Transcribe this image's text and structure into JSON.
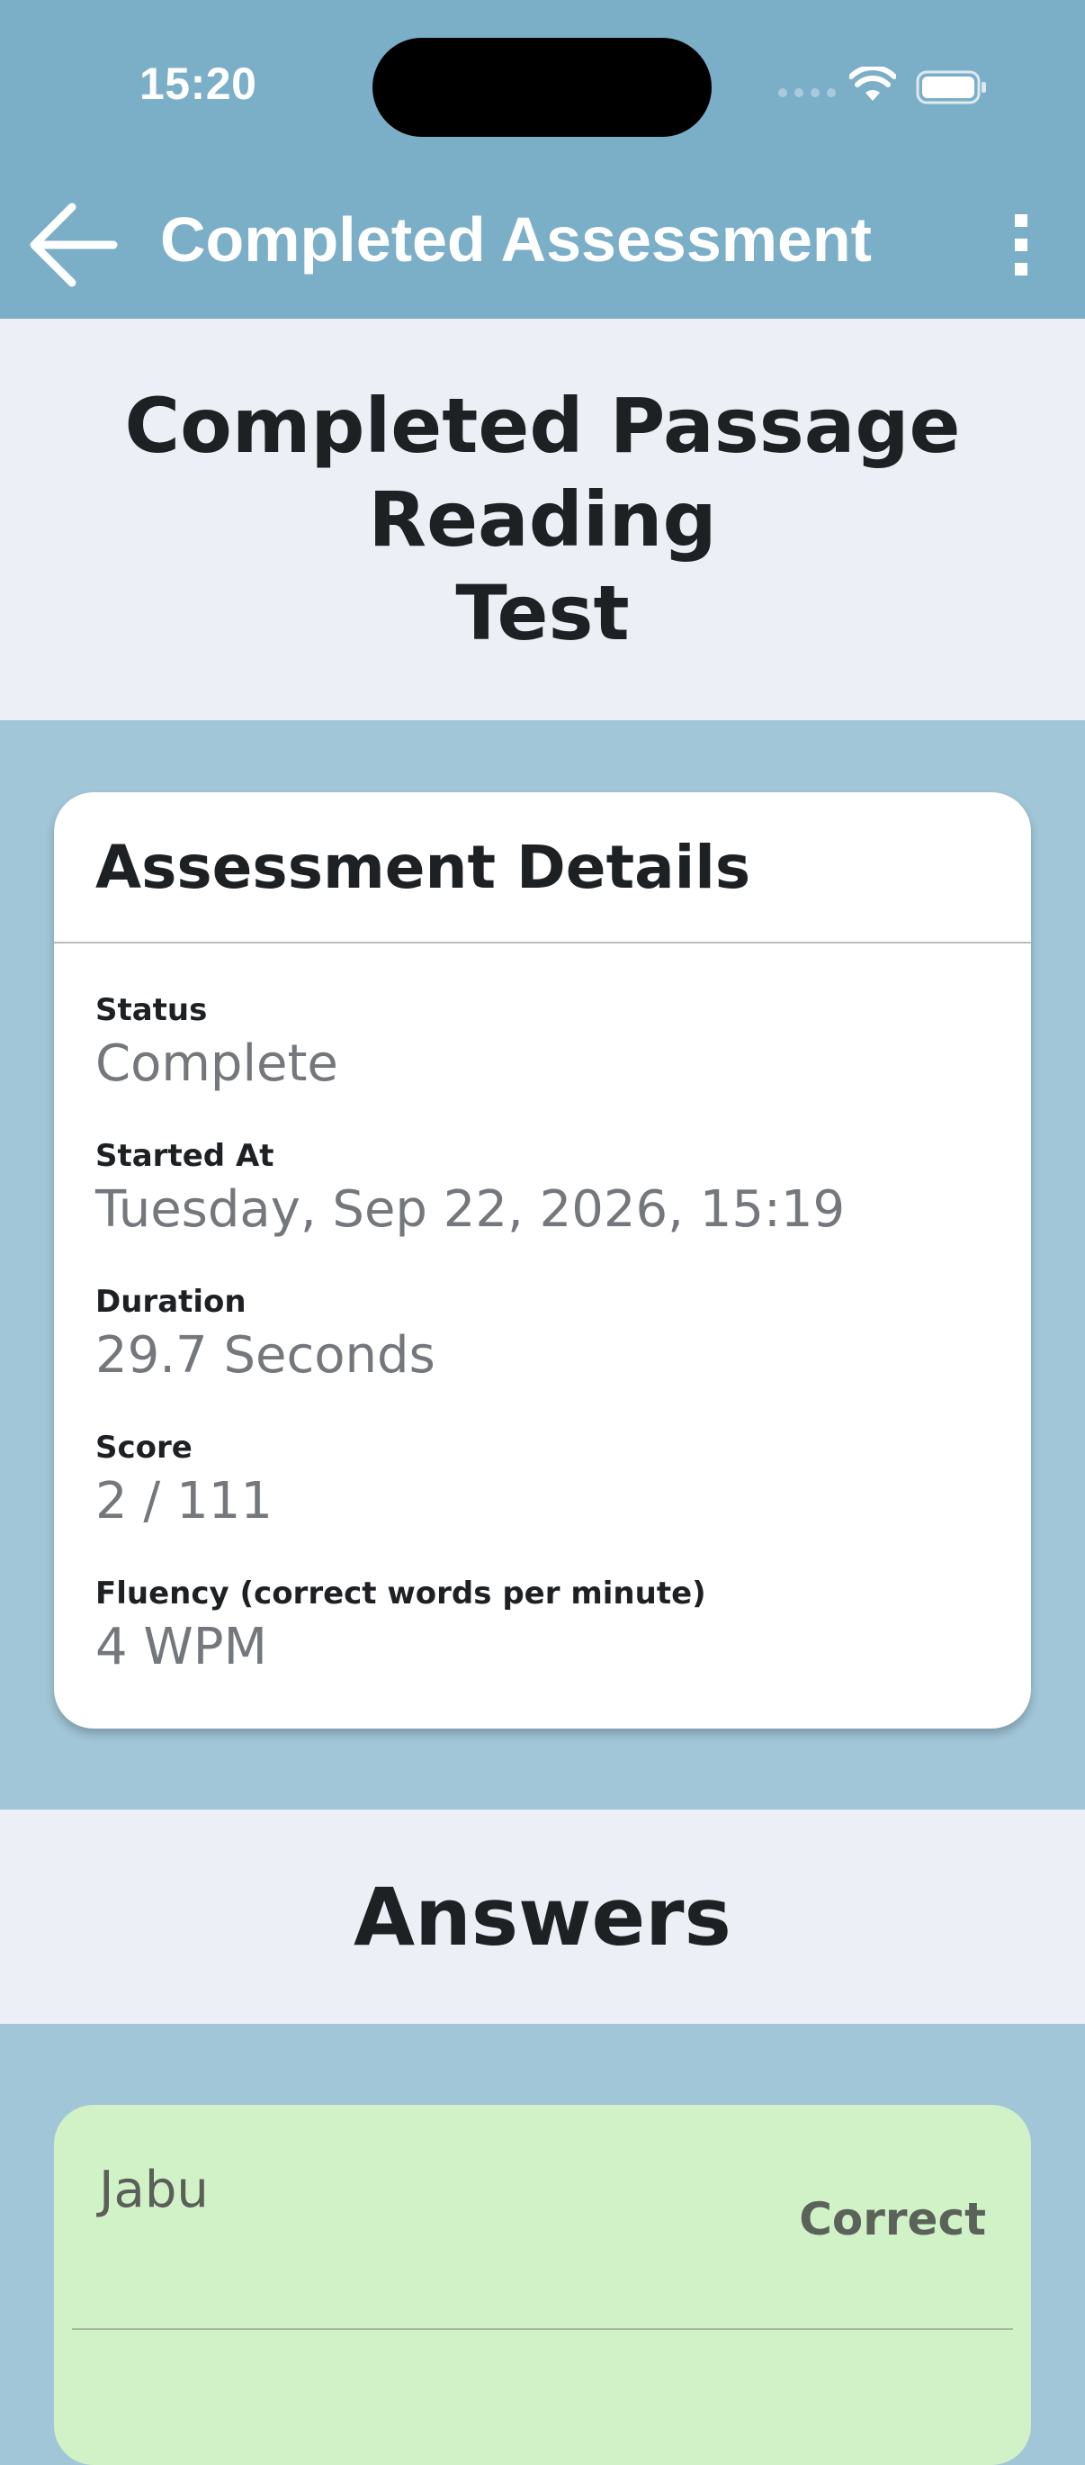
{
  "status_bar": {
    "time": "15:20"
  },
  "app_bar": {
    "title": "Completed Assessment",
    "back_icon": "arrow-left-icon",
    "menu_icon": "more-vertical-icon"
  },
  "page": {
    "title": "Completed Passage\nReading\nTest"
  },
  "details": {
    "title": "Assessment Details",
    "fields": [
      {
        "label": "Status",
        "value": "Complete"
      },
      {
        "label": "Started At",
        "value": "Tuesday, Sep 22, 2026, 15:19"
      },
      {
        "label": "Duration",
        "value": "29.7 Seconds"
      },
      {
        "label": "Score",
        "value": "2 / 111"
      },
      {
        "label": "Fluency (correct words per minute)",
        "value": "4 WPM"
      }
    ]
  },
  "answers": {
    "title": "Answers",
    "items": [
      {
        "word": "Jabu",
        "result": "Correct"
      }
    ]
  },
  "colors": {
    "app_bar": "#7bafc8",
    "background": "#a1c6d8",
    "band": "#ecf0f6",
    "correct_card": "#d1f2c7"
  }
}
